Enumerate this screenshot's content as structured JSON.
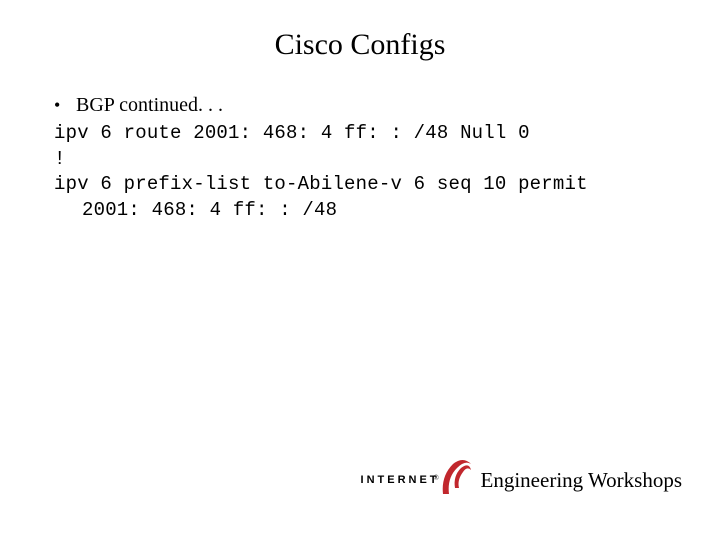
{
  "title": "Cisco Configs",
  "bullet": {
    "symbol": "•",
    "text": "BGP continued. . ."
  },
  "code": {
    "line1": "ipv 6 route 2001: 468: 4 ff: : /48 Null 0",
    "line2": "!",
    "line3": "ipv 6 prefix-list to-Abilene-v 6 seq 10 permit",
    "line4": "2001: 468: 4 ff: : /48"
  },
  "footer": {
    "logo_text": "INTERNET",
    "logo_mark": "®",
    "tagline": "Engineering Workshops"
  },
  "colors": {
    "swoosh": "#c1272d",
    "text": "#000000"
  }
}
